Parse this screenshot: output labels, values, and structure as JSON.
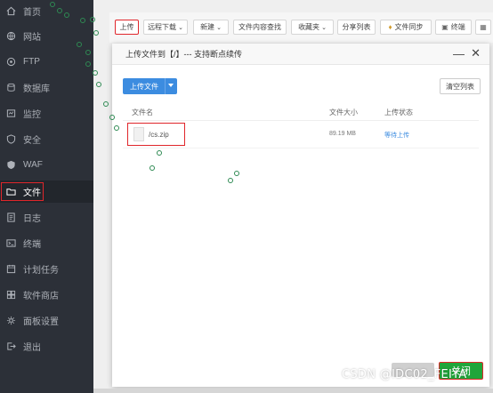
{
  "sidebar": {
    "items": [
      {
        "label": "首页",
        "icon": "home-icon",
        "glyph": "⌂",
        "active": false
      },
      {
        "label": "网站",
        "icon": "globe-icon",
        "glyph": "◎",
        "active": false
      },
      {
        "label": "FTP",
        "icon": "ftp-icon",
        "glyph": "◉",
        "active": false
      },
      {
        "label": "数据库",
        "icon": "database-icon",
        "glyph": "◍",
        "active": false
      },
      {
        "label": "监控",
        "icon": "monitor-icon",
        "glyph": "▣",
        "active": false
      },
      {
        "label": "安全",
        "icon": "shield-icon",
        "glyph": "◈",
        "active": false
      },
      {
        "label": "WAF",
        "icon": "waf-icon",
        "glyph": "◆",
        "active": false
      },
      {
        "label": "文件",
        "icon": "folder-icon",
        "glyph": "▭",
        "active": true
      },
      {
        "label": "日志",
        "icon": "log-icon",
        "glyph": "▤",
        "active": false
      },
      {
        "label": "终端",
        "icon": "terminal-icon",
        "glyph": "▥",
        "active": false
      },
      {
        "label": "计划任务",
        "icon": "schedule-icon",
        "glyph": "▦",
        "active": false
      },
      {
        "label": "软件商店",
        "icon": "store-icon",
        "glyph": "▧",
        "active": false
      },
      {
        "label": "面板设置",
        "icon": "settings-icon",
        "glyph": "✲",
        "active": false
      },
      {
        "label": "退出",
        "icon": "logout-icon",
        "glyph": "⇥",
        "active": false
      }
    ]
  },
  "toolbar": {
    "upload": "上传",
    "remote_download": "远程下载",
    "new": "新建",
    "content_search": "文件内容查找",
    "favorites": "收藏夹",
    "share_list": "分享列表",
    "file_sync": "文件同步",
    "terminal": "终端"
  },
  "modal": {
    "title": "上传文件到【/】--- 支持断点续传",
    "minimize": "—",
    "close": "✕",
    "upload_button": "上传文件",
    "clear_button": "清空列表",
    "columns": {
      "name": "文件名",
      "size": "文件大小",
      "status": "上传状态"
    },
    "files": [
      {
        "name": "/cs.zip",
        "size": "89.19 MB",
        "status": "等待上传"
      }
    ],
    "close_button": "关闭"
  },
  "watermark": "CSDN @IDC02_FEIYA",
  "colors": {
    "sidebar_bg": "#2c3038",
    "accent_blue": "#3c8ce0",
    "accent_green": "#20a53a",
    "highlight_red": "#e0262b"
  }
}
